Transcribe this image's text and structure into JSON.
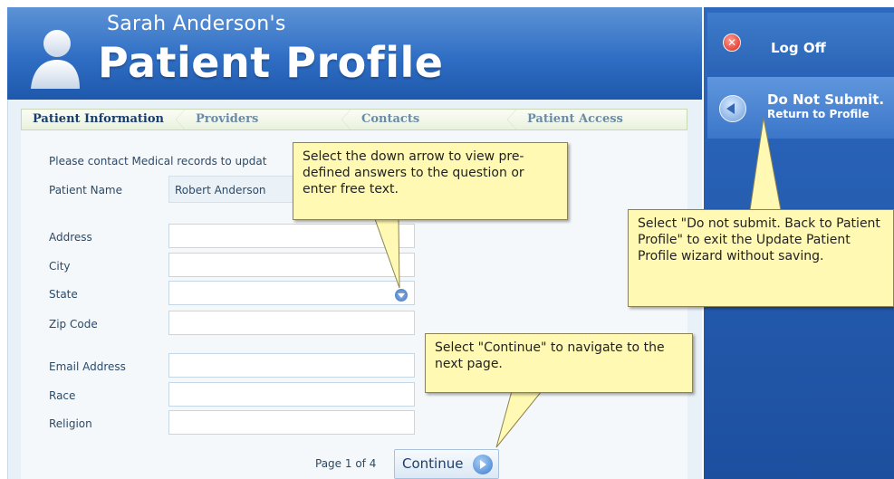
{
  "header": {
    "user_name": "Sarah Anderson's",
    "title": "Patient Profile"
  },
  "tabs": [
    {
      "label": "Patient Information",
      "active": true
    },
    {
      "label": "Providers",
      "active": false
    },
    {
      "label": "Contacts",
      "active": false
    },
    {
      "label": "Patient Access",
      "active": false
    }
  ],
  "form": {
    "notice": "Please contact Medical records to updat",
    "patient_name_label": "Patient Name",
    "patient_name_value": "Robert Anderson",
    "fields": {
      "address": "Address",
      "city": "City",
      "state": "State",
      "zip": "Zip Code",
      "email": "Email Address",
      "race": "Race",
      "religion": "Religion"
    },
    "page_indicator": "Page 1 of 4",
    "continue_label": "Continue"
  },
  "sidebar": {
    "logoff_label": "Log Off",
    "do_not_submit_line1": "Do Not Submit.",
    "do_not_submit_line2": "Return to Profile"
  },
  "callouts": {
    "dropdown_tip": "Select the down arrow to view pre-defined answers to the question or enter free text.",
    "do_not_submit_tip": "Select \"Do not submit. Back to Patient Profile\" to exit the Update Patient Profile wizard without saving.",
    "continue_tip": "Select \"Continue\" to navigate to the next page."
  },
  "colors": {
    "header_blue": "#2f6ec4",
    "sidebar_blue": "#1d4f9f",
    "callout_yellow": "#fff9b3"
  }
}
